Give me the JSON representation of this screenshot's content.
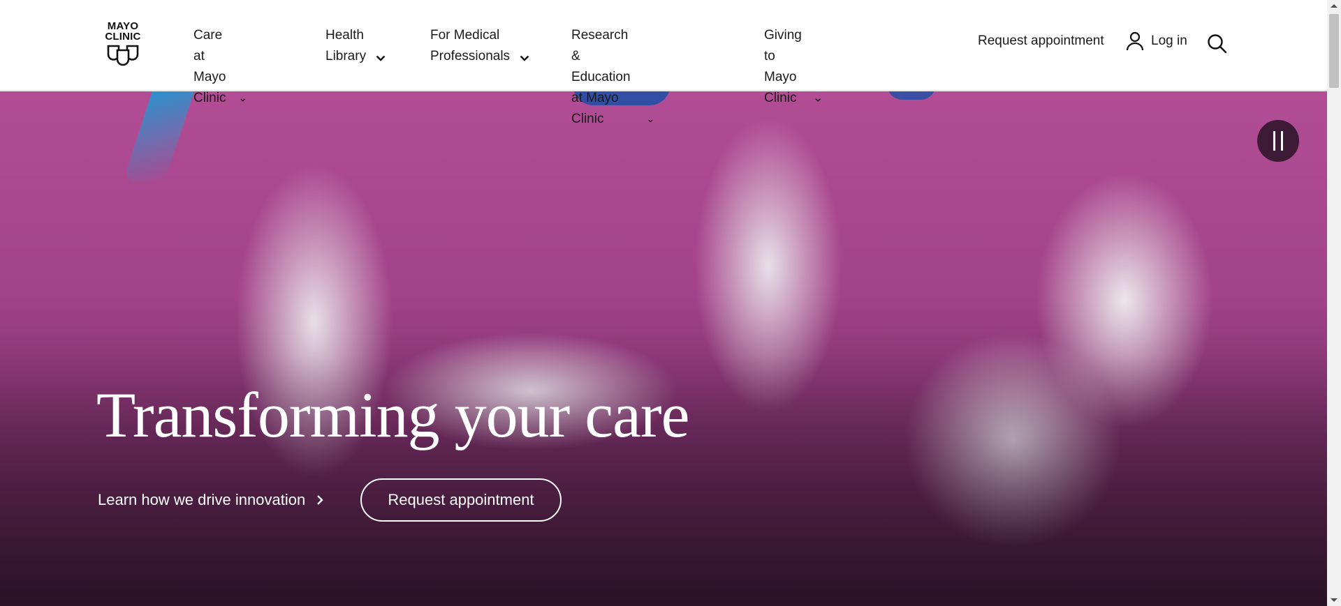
{
  "logo": {
    "line1": "MAYO",
    "line2": "CLINIC"
  },
  "nav": {
    "items": [
      {
        "line1": "Care at",
        "line2": "Mayo Clinic"
      },
      {
        "line1": "Health",
        "line2": "Library"
      },
      {
        "line1": "For Medical",
        "line2": "Professionals"
      },
      {
        "line1": "Research & Education",
        "line2": "at Mayo Clinic"
      },
      {
        "line1": "Giving to",
        "line2": "Mayo Clinic"
      }
    ],
    "request_appointment": "Request appointment",
    "login": "Log in"
  },
  "hero": {
    "headline": "Transforming your care",
    "learn_link": "Learn how we drive innovation",
    "request_button": "Request appointment"
  },
  "colors": {
    "accent": "#3d1a36",
    "hero_magenta": "#a24389"
  }
}
